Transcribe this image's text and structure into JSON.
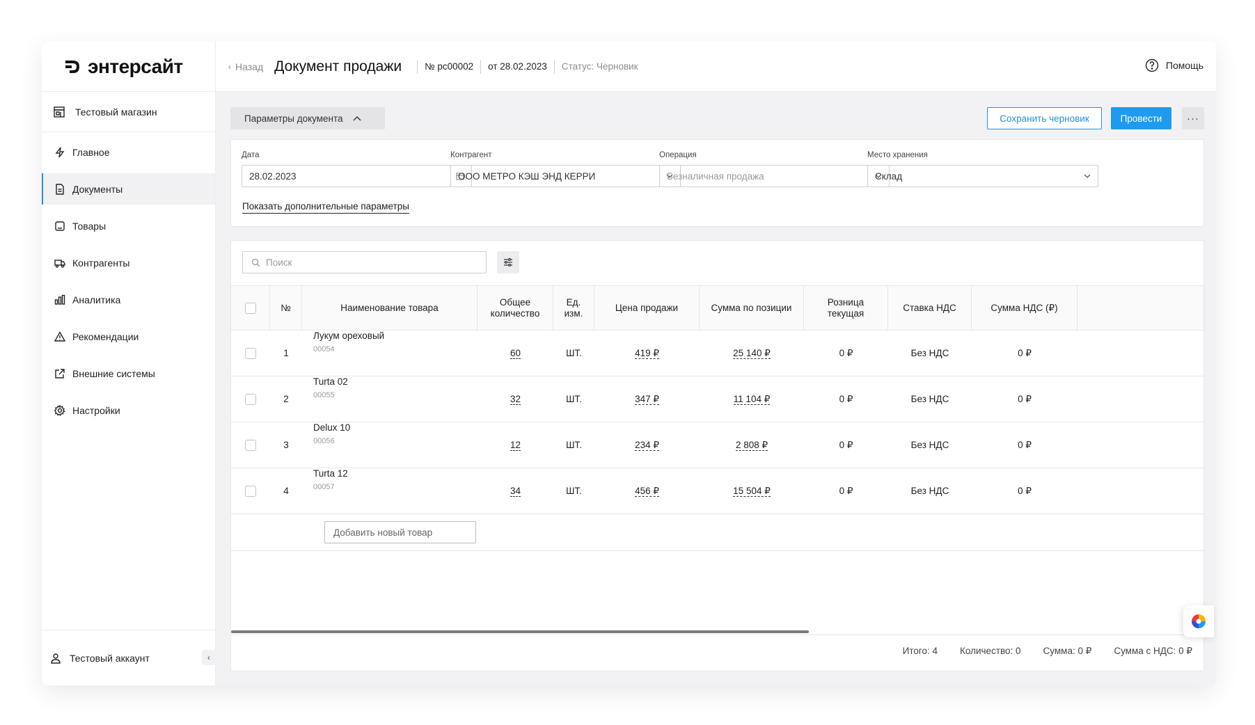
{
  "brand": {
    "name": "энтерсайт"
  },
  "store": {
    "name": "Тестовый магазин"
  },
  "nav": {
    "items": [
      {
        "label": "Главное"
      },
      {
        "label": "Документы"
      },
      {
        "label": "Товары"
      },
      {
        "label": "Контрагенты"
      },
      {
        "label": "Аналитика"
      },
      {
        "label": "Рекомендации"
      },
      {
        "label": "Внешние системы"
      },
      {
        "label": "Настройки"
      }
    ],
    "active": "Документы"
  },
  "account": {
    "name": "Тестовый аккаунт"
  },
  "header": {
    "back": "Назад",
    "title": "Документ продажи",
    "number": "№ рс00002",
    "date": "от 28.02.2023",
    "status": "Статус: Черновик",
    "help": "Помощь"
  },
  "toolbar": {
    "params_toggle": "Параметры документа",
    "save_draft": "Сохранить черновик",
    "post": "Провести",
    "more": "···"
  },
  "params": {
    "date": {
      "label": "Дата",
      "value": "28.02.2023"
    },
    "counterparty": {
      "label": "Контрагент",
      "value": "ООО МЕТРО КЭШ ЭНД КЕРРИ"
    },
    "operation": {
      "label": "Операция",
      "value": "Безналичная продажа"
    },
    "storage": {
      "label": "Место хранения",
      "value": "Склад"
    },
    "more_link": "Показать дополнительные параметры"
  },
  "table": {
    "search_placeholder": "Поиск",
    "columns": {
      "num": "№",
      "name": "Наименование товара",
      "qty": "Общее количество",
      "unit": "Ед. изм.",
      "price": "Цена продажи",
      "sum": "Сумма по позиции",
      "retail": "Розница текущая",
      "vat": "Ставка НДС",
      "vat_sum": "Сумма НДС (₽)"
    },
    "rows": [
      {
        "num": "1",
        "name": "Лукум ореховый",
        "code": "00054",
        "qty": "60",
        "unit": "ШТ.",
        "price": "419 ₽",
        "sum": "25 140 ₽",
        "retail": "0 ₽",
        "vat": "Без НДС",
        "vat_sum": "0 ₽"
      },
      {
        "num": "2",
        "name": "Turta 02",
        "code": "00055",
        "qty": "32",
        "unit": "ШТ.",
        "price": "347 ₽",
        "sum": "11 104 ₽",
        "retail": "0 ₽",
        "vat": "Без НДС",
        "vat_sum": "0 ₽"
      },
      {
        "num": "3",
        "name": "Delux 10",
        "code": "00056",
        "qty": "12",
        "unit": "ШТ.",
        "price": "234 ₽",
        "sum": "2 808 ₽",
        "retail": "0 ₽",
        "vat": "Без НДС",
        "vat_sum": "0 ₽"
      },
      {
        "num": "4",
        "name": "Turta 12",
        "code": "00057",
        "qty": "34",
        "unit": "ШТ.",
        "price": "456 ₽",
        "sum": "15 504 ₽",
        "retail": "0 ₽",
        "vat": "Без НДС",
        "vat_sum": "0 ₽"
      }
    ],
    "add_item": "Добавить новый товар"
  },
  "totals": {
    "total": "Итого: 4",
    "quantity": "Количество: 0",
    "sum": "Сумма: 0 ₽",
    "sum_vat": "Сумма с НДС: 0 ₽"
  },
  "colors": {
    "accent": "#1e9bf0",
    "accent_outline": "#2b8fd8"
  }
}
